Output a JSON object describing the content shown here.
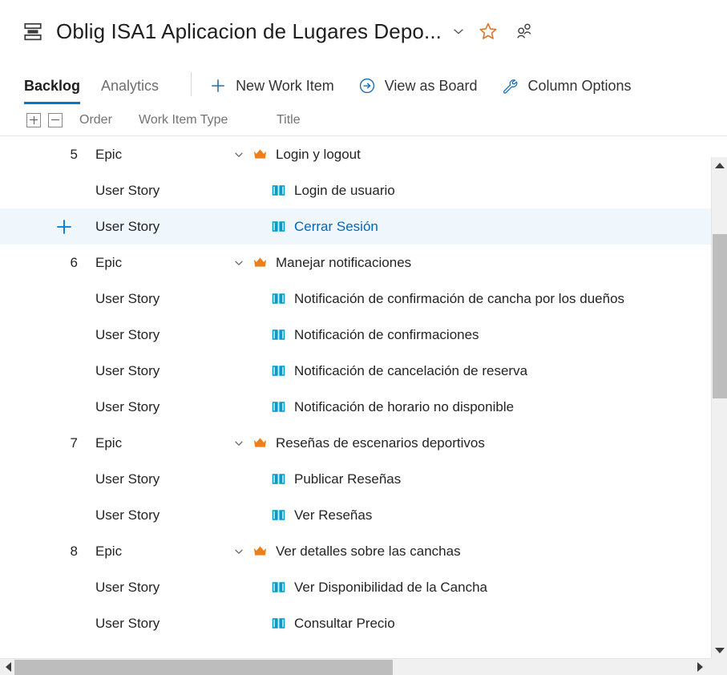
{
  "header": {
    "project_icon": "backlog-levels-icon",
    "title": "Oblig ISA1 Aplicacion de Lugares Depo...",
    "chevron_icon": "chevron-down-icon",
    "favorite_icon": "star-outline-icon",
    "team_icon": "team-members-icon",
    "accent_color": "#0078d4",
    "favorite_color": "#d8762a"
  },
  "commandbar": {
    "tabs": [
      {
        "label": "Backlog",
        "active": true
      },
      {
        "label": "Analytics",
        "active": false
      }
    ],
    "actions": [
      {
        "label": "New Work Item",
        "icon": "plus-icon"
      },
      {
        "label": "View as Board",
        "icon": "arrow-circle-right-icon"
      },
      {
        "label": "Column Options",
        "icon": "wrench-icon"
      }
    ]
  },
  "grid": {
    "expand_all_icon": "expand-all-icon",
    "collapse_all_icon": "collapse-all-icon",
    "columns": {
      "order": "Order",
      "type": "Work Item Type",
      "title": "Title"
    },
    "rows": [
      {
        "order": "5",
        "type": "Epic",
        "title": "Login y logout",
        "icon": "epic-crown-icon",
        "level": "parent",
        "selected": false,
        "expanded": true
      },
      {
        "order": "",
        "type": "User Story",
        "title": "Login de usuario",
        "icon": "user-story-book-icon",
        "level": "child",
        "selected": false
      },
      {
        "order": "",
        "type": "User Story",
        "title": "Cerrar Sesión",
        "icon": "user-story-book-icon",
        "level": "child",
        "selected": true,
        "add_icon": "add-item-plus-icon"
      },
      {
        "order": "6",
        "type": "Epic",
        "title": "Manejar notificaciones",
        "icon": "epic-crown-icon",
        "level": "parent",
        "selected": false,
        "expanded": true
      },
      {
        "order": "",
        "type": "User Story",
        "title": "Notificación de confirmación de cancha por los dueños",
        "icon": "user-story-book-icon",
        "level": "child",
        "selected": false
      },
      {
        "order": "",
        "type": "User Story",
        "title": "Notificación de confirmaciones",
        "icon": "user-story-book-icon",
        "level": "child",
        "selected": false
      },
      {
        "order": "",
        "type": "User Story",
        "title": "Notificación de cancelación de reserva",
        "icon": "user-story-book-icon",
        "level": "child",
        "selected": false
      },
      {
        "order": "",
        "type": "User Story",
        "title": "Notificación de horario no disponible",
        "icon": "user-story-book-icon",
        "level": "child",
        "selected": false
      },
      {
        "order": "7",
        "type": "Epic",
        "title": "Reseñas de escenarios deportivos",
        "icon": "epic-crown-icon",
        "level": "parent",
        "selected": false,
        "expanded": true
      },
      {
        "order": "",
        "type": "User Story",
        "title": "Publicar Reseñas",
        "icon": "user-story-book-icon",
        "level": "child",
        "selected": false
      },
      {
        "order": "",
        "type": "User Story",
        "title": "Ver Reseñas",
        "icon": "user-story-book-icon",
        "level": "child",
        "selected": false
      },
      {
        "order": "8",
        "type": "Epic",
        "title": "Ver detalles sobre las canchas",
        "icon": "epic-crown-icon",
        "level": "parent",
        "selected": false,
        "expanded": true
      },
      {
        "order": "",
        "type": "User Story",
        "title": "Ver Disponibilidad de la Cancha",
        "icon": "user-story-book-icon",
        "level": "child",
        "selected": false
      },
      {
        "order": "",
        "type": "User Story",
        "title": "Consultar Precio",
        "icon": "user-story-book-icon",
        "level": "child",
        "selected": false
      }
    ]
  },
  "scrollbars": {
    "vertical": {
      "up_icon": "scroll-up-arrow-icon",
      "down_icon": "scroll-down-arrow-icon"
    },
    "horizontal": {
      "left_icon": "scroll-left-arrow-icon",
      "right_icon": "scroll-right-arrow-icon"
    }
  },
  "colors": {
    "epic": "#ef7d1a",
    "user_story": "#009ccc",
    "accent": "#0078d4",
    "selected_row_bg": "#eff6fc"
  }
}
